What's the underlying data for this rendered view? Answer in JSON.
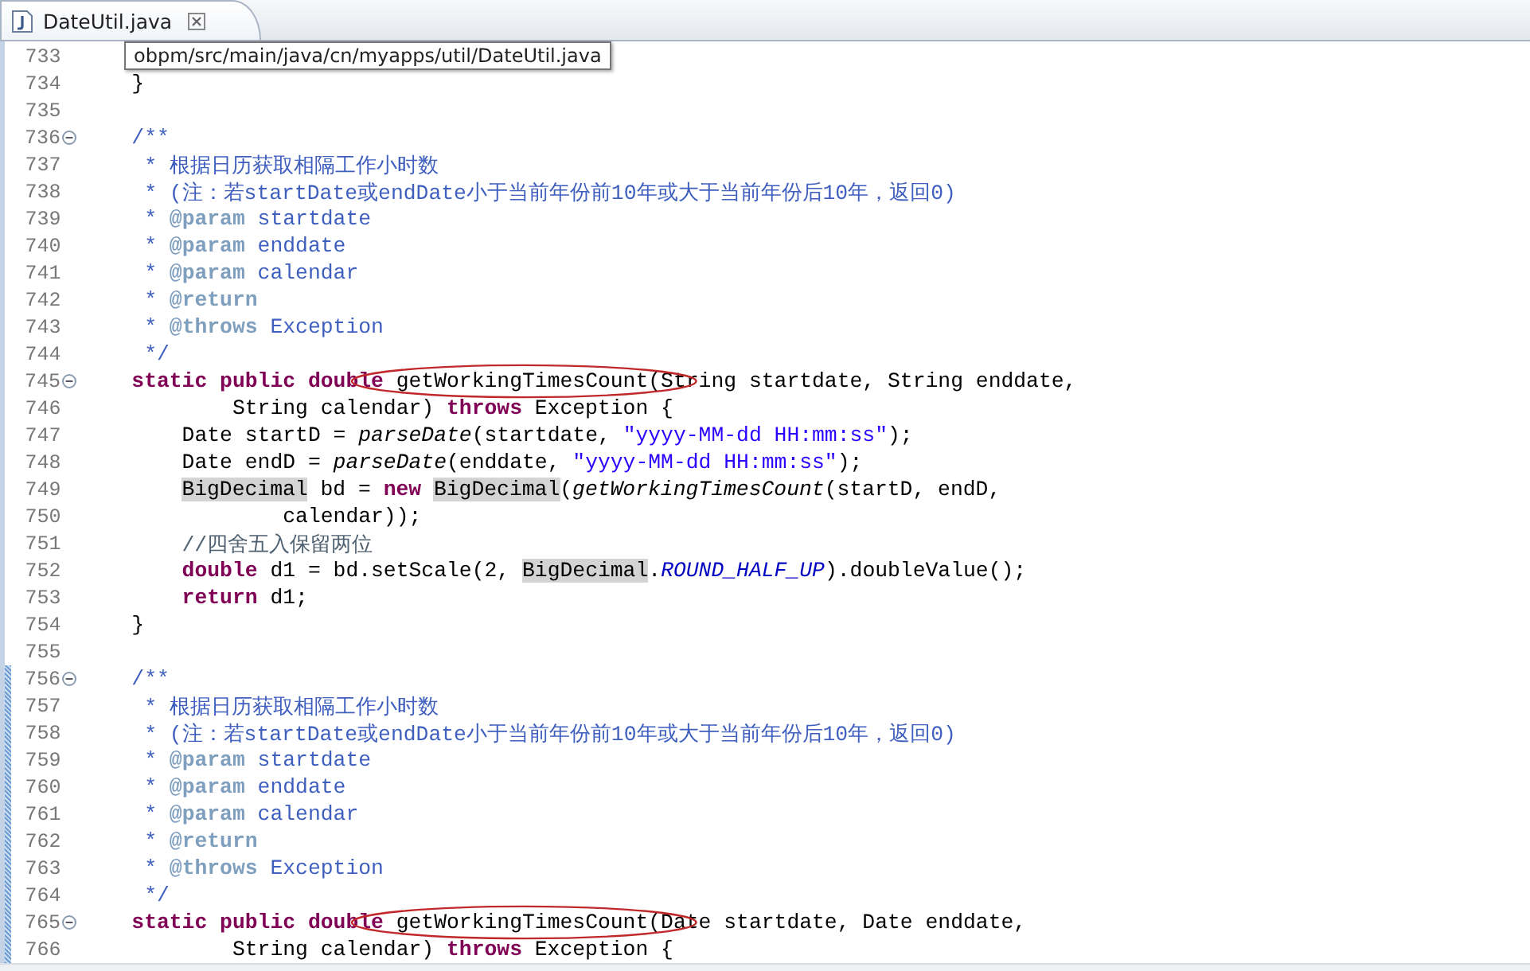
{
  "tab": {
    "label": "DateUtil.java",
    "selected": true
  },
  "tooltip": "obpm/src/main/java/cn/myapps/util/DateUtil.java",
  "lines": [
    {
      "number": "733",
      "fold": false,
      "changed": false
    },
    {
      "number": "734",
      "fold": false,
      "changed": false,
      "tokens": [
        {
          "kind": "plain",
          "text": "    }"
        }
      ]
    },
    {
      "number": "735",
      "fold": false,
      "changed": false
    },
    {
      "number": "736",
      "fold": true,
      "changed": false,
      "tokens": [
        {
          "kind": "javadoc",
          "text": "    /**"
        }
      ]
    },
    {
      "number": "737",
      "fold": false,
      "changed": false,
      "tokens": [
        {
          "kind": "javadoc",
          "text": "     * 根据日历获取相隔工作小时数"
        }
      ]
    },
    {
      "number": "738",
      "fold": false,
      "changed": false,
      "tokens": [
        {
          "kind": "javadoc",
          "text": "     * (注：若startDate或endDate小于当前年份前10年或大于当前年份后10年，返回0)"
        }
      ]
    },
    {
      "number": "739",
      "fold": false,
      "changed": false,
      "tokens": [
        {
          "kind": "javadoc",
          "text": "     * "
        },
        {
          "kind": "tag",
          "text": "@param"
        },
        {
          "kind": "javadoc",
          "text": " startdate"
        }
      ]
    },
    {
      "number": "740",
      "fold": false,
      "changed": false,
      "tokens": [
        {
          "kind": "javadoc",
          "text": "     * "
        },
        {
          "kind": "tag",
          "text": "@param"
        },
        {
          "kind": "javadoc",
          "text": " enddate"
        }
      ]
    },
    {
      "number": "741",
      "fold": false,
      "changed": false,
      "tokens": [
        {
          "kind": "javadoc",
          "text": "     * "
        },
        {
          "kind": "tag",
          "text": "@param"
        },
        {
          "kind": "javadoc",
          "text": " calendar"
        }
      ]
    },
    {
      "number": "742",
      "fold": false,
      "changed": false,
      "tokens": [
        {
          "kind": "javadoc",
          "text": "     * "
        },
        {
          "kind": "tag",
          "text": "@return"
        }
      ]
    },
    {
      "number": "743",
      "fold": false,
      "changed": false,
      "tokens": [
        {
          "kind": "javadoc",
          "text": "     * "
        },
        {
          "kind": "tag",
          "text": "@throws"
        },
        {
          "kind": "javadoc",
          "text": " Exception"
        }
      ]
    },
    {
      "number": "744",
      "fold": false,
      "changed": false,
      "tokens": [
        {
          "kind": "javadoc",
          "text": "     */"
        }
      ]
    },
    {
      "number": "745",
      "fold": true,
      "changed": false,
      "tokens": [
        {
          "kind": "keyword",
          "text": "    static public double "
        },
        {
          "kind": "circled",
          "text": "getWorkingTimesCount"
        },
        {
          "kind": "plain",
          "text": "(String startdate, String enddate,"
        }
      ]
    },
    {
      "number": "746",
      "fold": false,
      "changed": false,
      "tokens": [
        {
          "kind": "plain",
          "text": "            String calendar) "
        },
        {
          "kind": "keyword",
          "text": "throws"
        },
        {
          "kind": "plain",
          "text": " Exception {"
        }
      ]
    },
    {
      "number": "747",
      "fold": false,
      "changed": false,
      "tokens": [
        {
          "kind": "plain",
          "text": "        Date startD = "
        },
        {
          "kind": "italic",
          "text": "parseDate"
        },
        {
          "kind": "plain",
          "text": "(startdate, "
        },
        {
          "kind": "string",
          "text": "\"yyyy-MM-dd HH:mm:ss\""
        },
        {
          "kind": "plain",
          "text": ");"
        }
      ]
    },
    {
      "number": "748",
      "fold": false,
      "changed": false,
      "tokens": [
        {
          "kind": "plain",
          "text": "        Date endD = "
        },
        {
          "kind": "italic",
          "text": "parseDate"
        },
        {
          "kind": "plain",
          "text": "(enddate, "
        },
        {
          "kind": "string",
          "text": "\"yyyy-MM-dd HH:mm:ss\""
        },
        {
          "kind": "plain",
          "text": ");"
        }
      ]
    },
    {
      "number": "749",
      "fold": false,
      "changed": false,
      "tokens": [
        {
          "kind": "occurrence",
          "text": "BigDecimal"
        },
        {
          "kind": "plain",
          "text": " bd = "
        },
        {
          "kind": "keyword",
          "text": "new "
        },
        {
          "kind": "occurrence",
          "text": "BigDecimal"
        },
        {
          "kind": "plain",
          "text": "("
        },
        {
          "kind": "italic",
          "text": "getWorkingTimesCount"
        },
        {
          "kind": "plain",
          "text": "(startD, endD,"
        }
      ]
    },
    {
      "number": "750",
      "fold": false,
      "changed": false,
      "tokens": [
        {
          "kind": "plain",
          "text": "                calendar));"
        }
      ]
    },
    {
      "number": "751",
      "fold": false,
      "changed": false,
      "tokens": [
        {
          "kind": "comment",
          "text": "//四舍五入保留两位"
        }
      ]
    },
    {
      "number": "752",
      "fold": false,
      "changed": false,
      "tokens": [
        {
          "kind": "keyword",
          "text": "        double"
        },
        {
          "kind": "plain",
          "text": " d1 = bd.setScale(2, "
        },
        {
          "kind": "occurrence",
          "text": "BigDecimal"
        },
        {
          "kind": "plain",
          "text": "."
        },
        {
          "kind": "constant",
          "text": "ROUND_HALF_UP"
        },
        {
          "kind": "plain",
          "text": ").doubleValue();"
        }
      ]
    },
    {
      "number": "753",
      "fold": false,
      "changed": false,
      "tokens": [
        {
          "kind": "keyword",
          "text": "        return"
        },
        {
          "kind": "plain",
          "text": " d1;"
        }
      ]
    },
    {
      "number": "754",
      "fold": false,
      "changed": false,
      "tokens": [
        {
          "kind": "plain",
          "text": "    }"
        }
      ]
    },
    {
      "number": "755",
      "fold": false,
      "changed": false
    },
    {
      "number": "756",
      "fold": true,
      "changed": true,
      "tokens": [
        {
          "kind": "javadoc",
          "text": "    /**"
        }
      ]
    },
    {
      "number": "757",
      "fold": false,
      "changed": true,
      "tokens": [
        {
          "kind": "javadoc",
          "text": "     * 根据日历获取相隔工作小时数"
        }
      ]
    },
    {
      "number": "758",
      "fold": false,
      "changed": true,
      "tokens": [
        {
          "kind": "javadoc",
          "text": "     * (注：若startDate或endDate小于当前年份前10年或大于当前年份后10年，返回0)"
        }
      ]
    },
    {
      "number": "759",
      "fold": false,
      "changed": true,
      "tokens": [
        {
          "kind": "javadoc",
          "text": "     * "
        },
        {
          "kind": "tag",
          "text": "@param"
        },
        {
          "kind": "javadoc",
          "text": " startdate"
        }
      ]
    },
    {
      "number": "760",
      "fold": false,
      "changed": true,
      "tokens": [
        {
          "kind": "javadoc",
          "text": "     * "
        },
        {
          "kind": "tag",
          "text": "@param"
        },
        {
          "kind": "javadoc",
          "text": " enddate"
        }
      ]
    },
    {
      "number": "761",
      "fold": false,
      "changed": true,
      "tokens": [
        {
          "kind": "javadoc",
          "text": "     * "
        },
        {
          "kind": "tag",
          "text": "@param"
        },
        {
          "kind": "javadoc",
          "text": " calendar"
        }
      ]
    },
    {
      "number": "762",
      "fold": false,
      "changed": true,
      "tokens": [
        {
          "kind": "javadoc",
          "text": "     * "
        },
        {
          "kind": "tag",
          "text": "@return"
        }
      ]
    },
    {
      "number": "763",
      "fold": false,
      "changed": true,
      "tokens": [
        {
          "kind": "javadoc",
          "text": "     * "
        },
        {
          "kind": "tag",
          "text": "@throws"
        },
        {
          "kind": "javadoc",
          "text": " Exception"
        }
      ]
    },
    {
      "number": "764",
      "fold": false,
      "changed": true,
      "tokens": [
        {
          "kind": "javadoc",
          "text": "     */"
        }
      ]
    },
    {
      "number": "765",
      "fold": true,
      "changed": true,
      "tokens": [
        {
          "kind": "keyword",
          "text": "    static public double "
        },
        {
          "kind": "circled",
          "text": "getWorkingTimesCount"
        },
        {
          "kind": "plain",
          "text": "(Date startdate, Date enddate,"
        }
      ]
    },
    {
      "number": "766",
      "fold": false,
      "changed": true,
      "tokens": [
        {
          "kind": "plain",
          "text": "            String calendar) "
        },
        {
          "kind": "keyword",
          "text": "throws"
        },
        {
          "kind": "plain",
          "text": " Exception {"
        }
      ]
    }
  ]
}
